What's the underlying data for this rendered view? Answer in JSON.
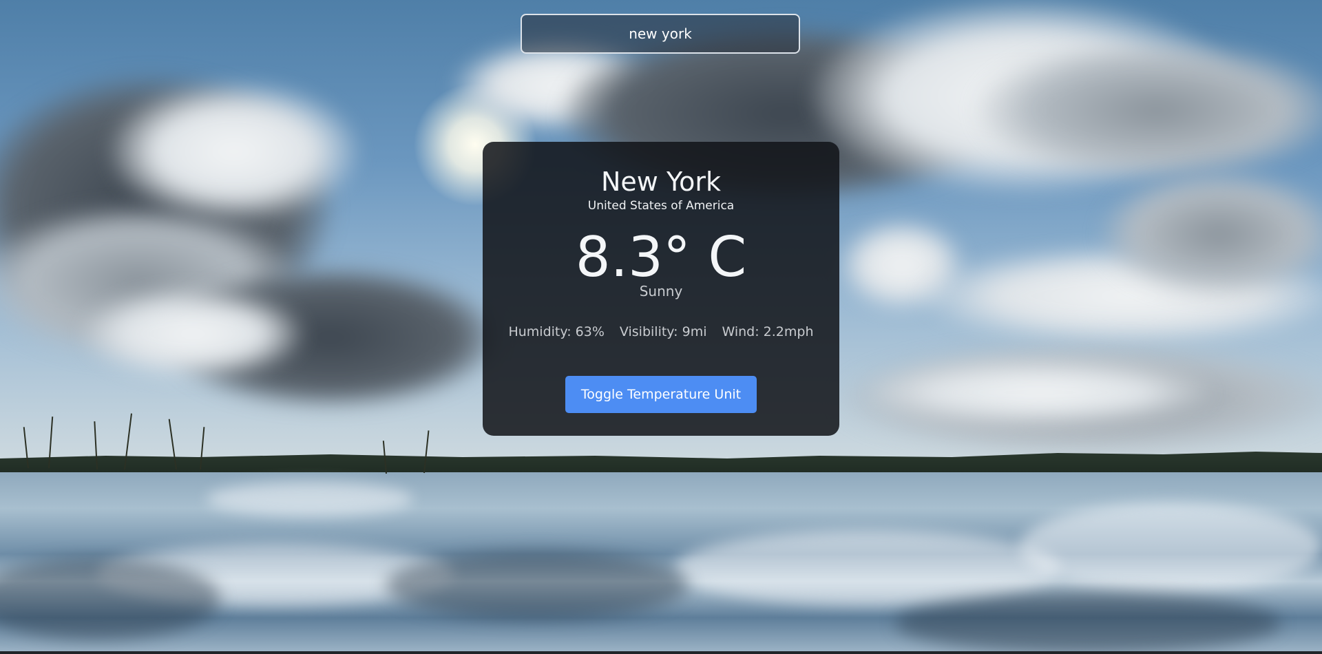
{
  "search": {
    "value": "new york"
  },
  "weather": {
    "city": "New York",
    "country": "United States of America",
    "temperature": "8.3° C",
    "condition": "Sunny",
    "humidity": "Humidity: 63%",
    "visibility": "Visibility: 9mi",
    "wind": "Wind: 2.2mph",
    "toggle_label": "Toggle Temperature Unit"
  },
  "colors": {
    "button": "#4d8df3",
    "card": "#121418"
  }
}
